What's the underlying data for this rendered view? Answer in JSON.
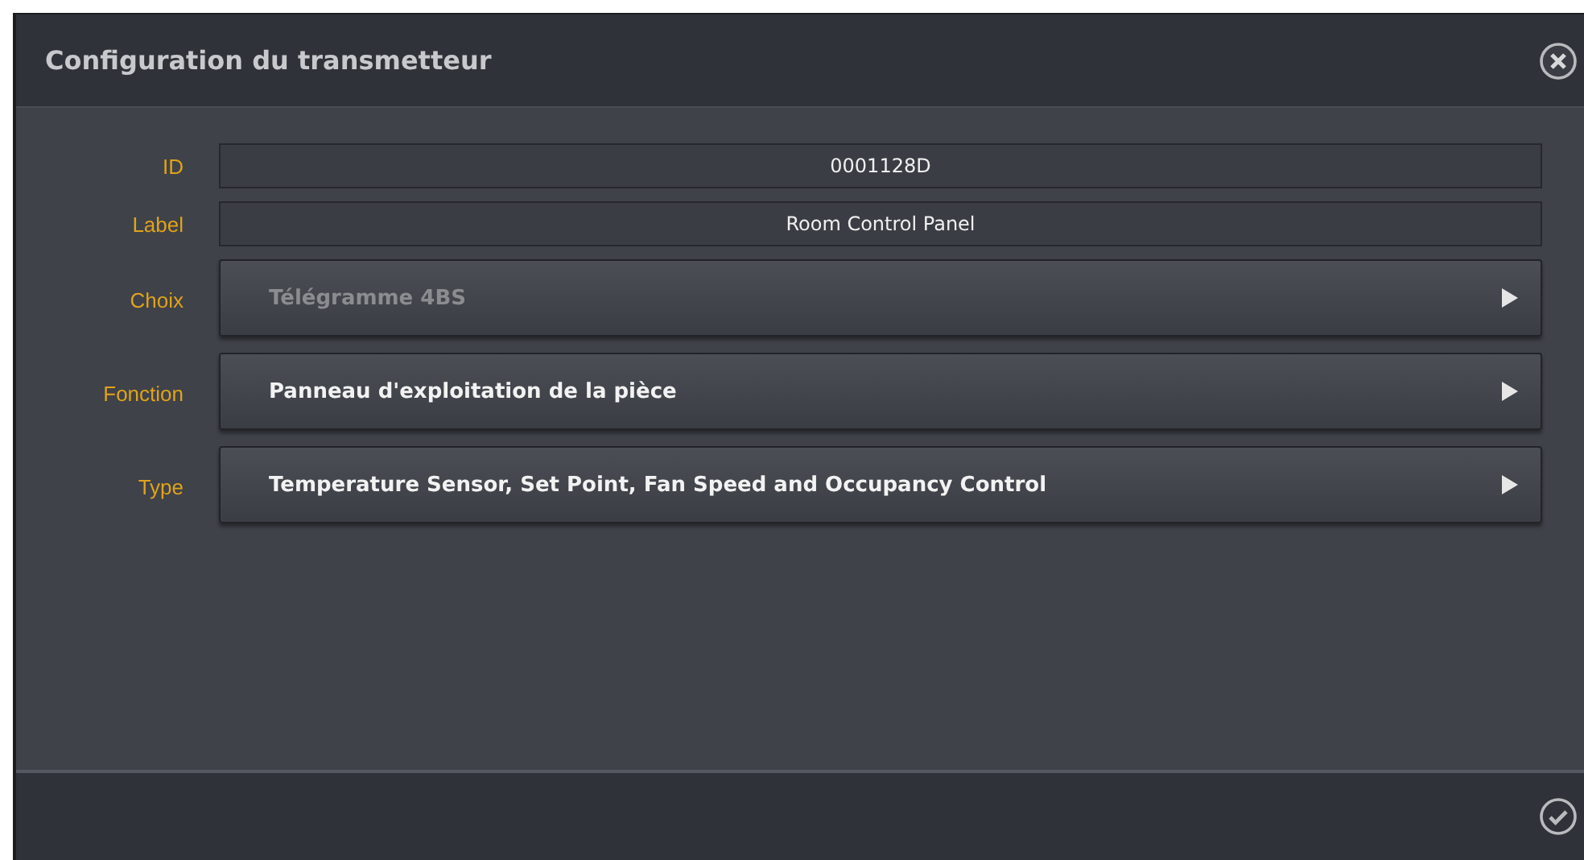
{
  "window": {
    "title": "Configuration du transmetteur"
  },
  "fields": [
    {
      "label": "ID",
      "kind": "text",
      "value": "0001128D"
    },
    {
      "label": "Label",
      "kind": "text",
      "value": "Room Control Panel"
    },
    {
      "label": "Choix",
      "kind": "select",
      "value": "Télégramme 4BS",
      "disabled": true
    },
    {
      "label": "Fonction",
      "kind": "select",
      "value": "Panneau d'exploitation de la pièce",
      "disabled": false
    },
    {
      "label": "Type",
      "kind": "select",
      "value": "Temperature Sensor, Set Point, Fan Speed and Occupancy Control",
      "disabled": false
    }
  ]
}
